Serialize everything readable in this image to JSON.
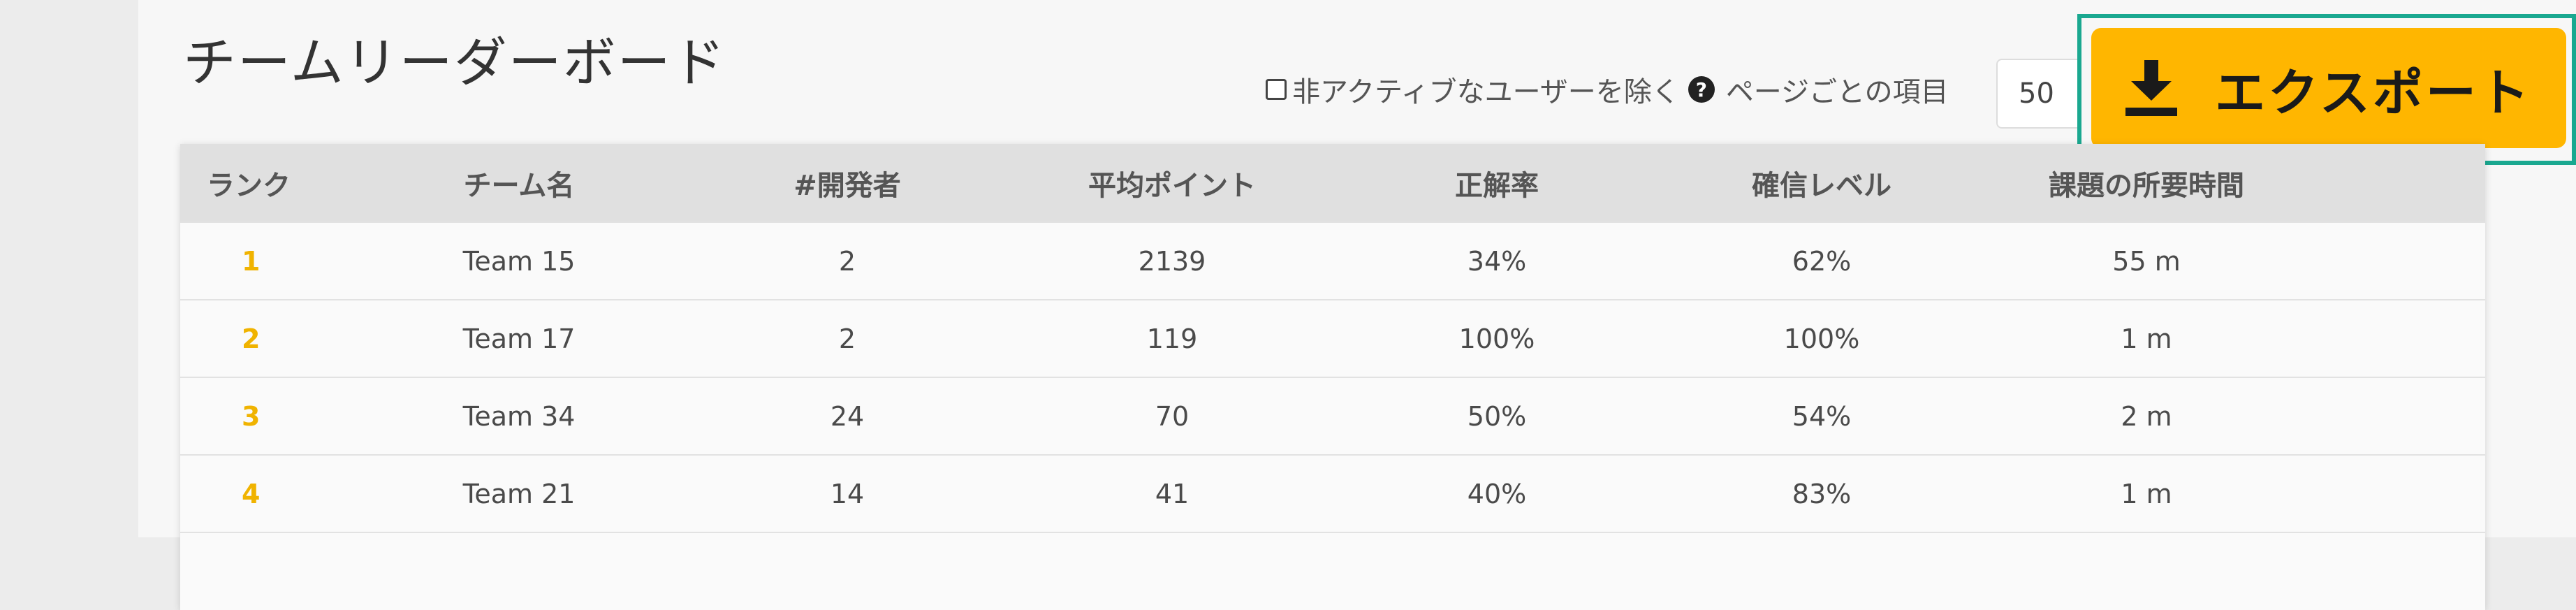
{
  "page_title": "チームリーダーボード",
  "filters": {
    "exclude_inactive_label": "非アクティブなユーザーを除く",
    "exclude_inactive_checked": false,
    "help_icon": "question-circle-icon",
    "per_page_label": "ページごとの項目",
    "per_page_value": "50"
  },
  "export": {
    "label": "エクスポート",
    "icon": "download-icon",
    "color": "#ffb600",
    "highlight_color": "#1aa890"
  },
  "table": {
    "headers": {
      "rank": "ランク",
      "team_name": "チーム名",
      "developers": "#開発者",
      "avg_points": "平均ポイント",
      "accuracy": "正解率",
      "confidence": "確信レベル",
      "time": "課題の所要時間"
    },
    "rows": [
      {
        "rank": "1",
        "team": "Team 15",
        "devs": "2",
        "points": "2139",
        "accuracy": "34%",
        "confidence": "62%",
        "time": "55 m"
      },
      {
        "rank": "2",
        "team": "Team 17",
        "devs": "2",
        "points": "119",
        "accuracy": "100%",
        "confidence": "100%",
        "time": "1 m"
      },
      {
        "rank": "3",
        "team": "Team 34",
        "devs": "24",
        "points": "70",
        "accuracy": "50%",
        "confidence": "54%",
        "time": "2 m"
      },
      {
        "rank": "4",
        "team": "Team 21",
        "devs": "14",
        "points": "41",
        "accuracy": "40%",
        "confidence": "83%",
        "time": "1 m"
      }
    ],
    "rank_color": "#f0b300"
  }
}
